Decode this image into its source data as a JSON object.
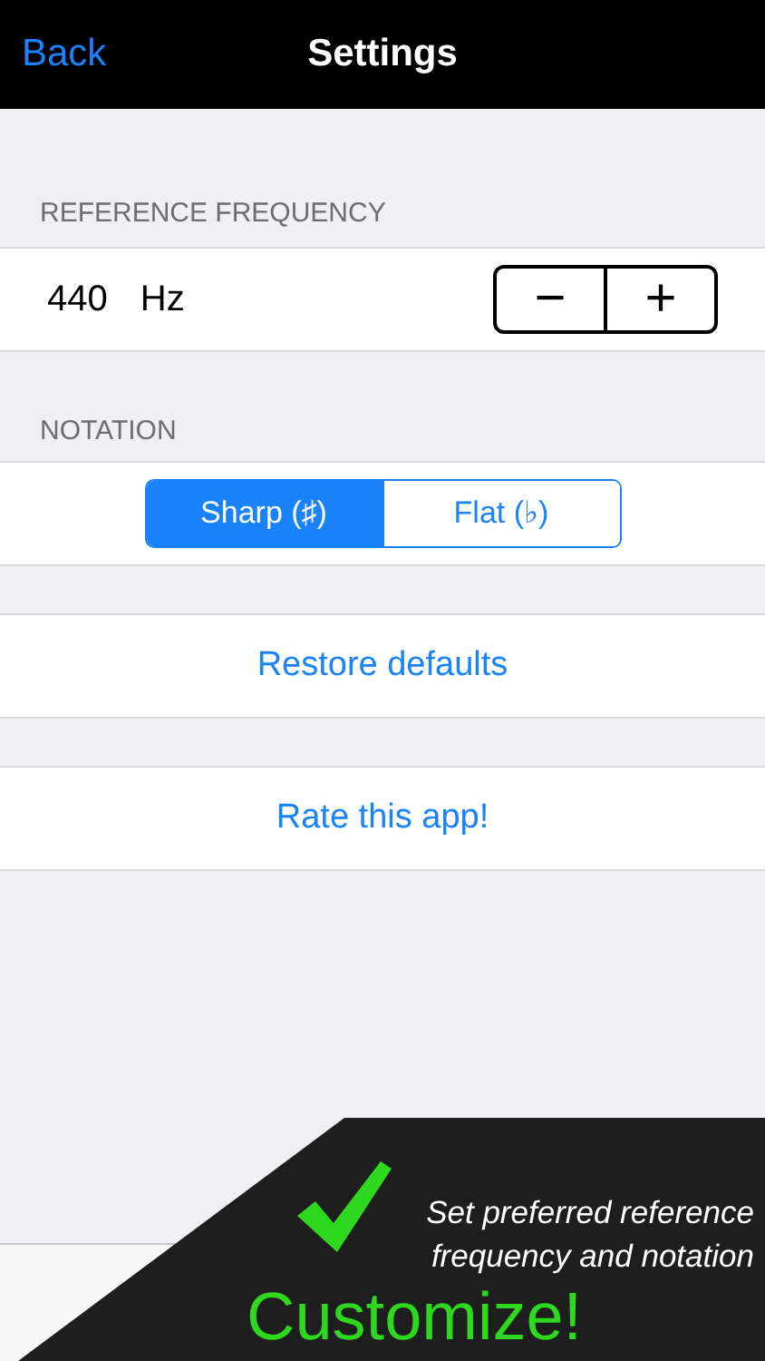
{
  "nav": {
    "back": "Back",
    "title": "Settings"
  },
  "reference": {
    "header": "REFERENCE FREQUENCY",
    "value": "440",
    "unit": "Hz",
    "minus": "−",
    "plus": "+"
  },
  "notation": {
    "header": "NOTATION",
    "options": [
      {
        "label": "Sharp (♯)",
        "selected": true
      },
      {
        "label": "Flat (♭)",
        "selected": false
      }
    ]
  },
  "actions": [
    "Restore defaults",
    "Rate this app!"
  ],
  "promo": {
    "caption": "Set preferred reference frequency and notation",
    "headline": "Customize!"
  }
}
